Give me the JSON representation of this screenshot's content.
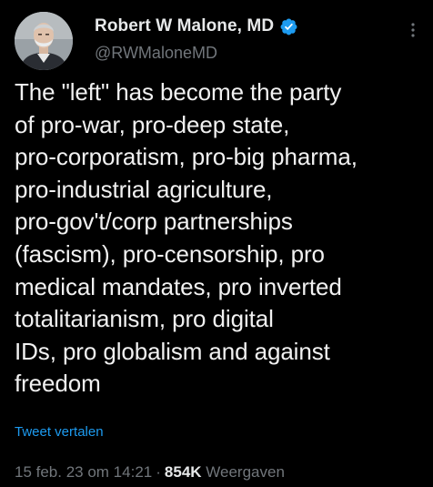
{
  "author": {
    "display_name": "Robert W Malone, MD",
    "handle": "@RWMaloneMD",
    "verified_icon": "verified-badge-icon",
    "avatar_icon": "profile-photo"
  },
  "tweet": {
    "text": "The \"left\" has become the party\nof pro-war, pro-deep state,\npro-corporatism, pro-big pharma,\npro-industrial agriculture,\npro-gov't/corp partnerships\n(fascism), pro-censorship, pro\nmedical mandates, pro inverted\ntotalitarianism, pro digital\nIDs, pro globalism and against\nfreedom",
    "translate_label": "Tweet vertalen"
  },
  "meta": {
    "timestamp": "15 feb. 23 om 14:21",
    "separator": "·",
    "views_count": "854K",
    "views_label": "Weergaven"
  },
  "colors": {
    "background": "#000000",
    "text_primary": "#e7e9ea",
    "text_secondary": "#71767b",
    "link_blue": "#1d9bf0",
    "verified_blue": "#1d9bf0"
  },
  "icons": {
    "more": "more-options-icon"
  }
}
